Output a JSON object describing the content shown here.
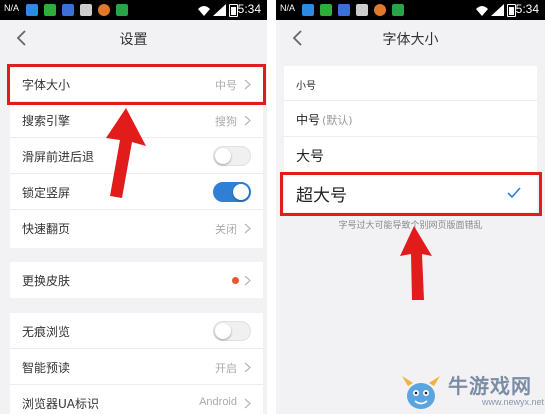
{
  "status_bar": {
    "carrier": "N/A",
    "time": "5:34"
  },
  "left_screen": {
    "title": "设置",
    "group1": [
      {
        "label": "字体大小",
        "value": "中号",
        "control": "chevron"
      },
      {
        "label": "搜索引擎",
        "value": "搜狗",
        "control": "chevron"
      },
      {
        "label": "滑屏前进后退",
        "control": "toggle",
        "state": "off"
      },
      {
        "label": "锁定竖屏",
        "control": "toggle",
        "state": "on"
      },
      {
        "label": "快速翻页",
        "value": "关闭",
        "control": "chevron"
      }
    ],
    "group2": [
      {
        "label": "更换皮肤",
        "control": "dot"
      }
    ],
    "group3": [
      {
        "label": "无痕浏览",
        "control": "toggle",
        "state": "off"
      },
      {
        "label": "智能预读",
        "value": "开启",
        "control": "chevron"
      },
      {
        "label": "浏览器UA标识",
        "value": "Android",
        "control": "chevron"
      }
    ]
  },
  "right_screen": {
    "title": "字体大小",
    "options": [
      {
        "label": "小号",
        "selected": false
      },
      {
        "label": "中号",
        "suffix": "(默认)",
        "selected": false
      },
      {
        "label": "大号",
        "selected": false
      },
      {
        "label": "超大号",
        "selected": true
      }
    ],
    "hint": "字号过大可能导致个别网页版面错乱"
  },
  "watermark": {
    "brand": "牛游戏网",
    "url": "www.newyx.net"
  },
  "colors": {
    "accent_blue": "#2f7fd6",
    "annotation_red": "#e21b1b",
    "skin_dot": "#e55a2b",
    "background": "#f2f2f4"
  }
}
